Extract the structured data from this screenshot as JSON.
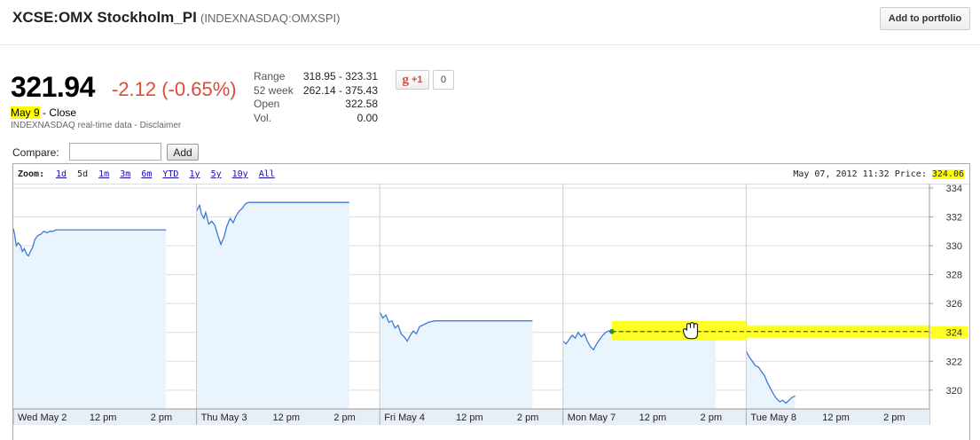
{
  "header": {
    "title": "XCSE:OMX Stockholm_PI",
    "subtitle": "(INDEXNASDAQ:OMXSPI)",
    "add_portfolio": "Add to portfolio"
  },
  "quote": {
    "price": "321.94",
    "change": "-2.12 (-0.65%)",
    "date": "May 9",
    "close_label": "- Close",
    "source": "INDEXNASDAQ real-time data - Disclaimer",
    "colors": {
      "negative": "#dd4b39",
      "highlight": "#ffff00"
    }
  },
  "stats": [
    {
      "label": "Range",
      "value": "318.95 - 323.31"
    },
    {
      "label": "52 week",
      "value": "262.14 - 375.43"
    },
    {
      "label": "Open",
      "value": "322.58"
    },
    {
      "label": "Vol.",
      "value": "0.00"
    }
  ],
  "social": {
    "plus_one": "+1",
    "g_letter": "g",
    "count": "0"
  },
  "compare": {
    "label": "Compare:",
    "value": "",
    "add": "Add"
  },
  "chart_toolbar": {
    "zoom_label": "Zoom:",
    "zoom_options": [
      "1d",
      "5d",
      "1m",
      "3m",
      "6m",
      "YTD",
      "1y",
      "5y",
      "10y",
      "All"
    ],
    "active_zoom": "5d",
    "readout_prefix": "May 07, 2012 11:32 Price:",
    "readout_price": "324.06"
  },
  "chart_data": {
    "type": "area",
    "x_tick_labels": [
      "Wed May 2",
      "12 pm",
      "2 pm",
      "Thu May 3",
      "12 pm",
      "2 pm",
      "Fri May 4",
      "12 pm",
      "2 pm",
      "Mon May 7",
      "12 pm",
      "2 pm",
      "Tue May 8",
      "12 pm",
      "2 pm"
    ],
    "y_ticks": [
      320,
      322,
      324,
      326,
      328,
      330,
      332,
      334
    ],
    "ylim": [
      318.7,
      334.3
    ],
    "reference_line": 324.06,
    "colors": {
      "line": "#3a7bd5",
      "fill": "#eaf4fc",
      "grid": "#dddddd",
      "reference": "#333333",
      "marker": "#2e8b2e"
    },
    "series": [
      {
        "values": [
          [
            0.0,
            331.2
          ],
          [
            0.02,
            330.8
          ],
          [
            0.05,
            330.0
          ],
          [
            0.08,
            330.2
          ],
          [
            0.12,
            330.0
          ],
          [
            0.15,
            329.6
          ],
          [
            0.18,
            329.8
          ],
          [
            0.22,
            329.4
          ],
          [
            0.25,
            329.3
          ],
          [
            0.28,
            329.6
          ],
          [
            0.32,
            329.9
          ],
          [
            0.35,
            330.4
          ],
          [
            0.4,
            330.7
          ],
          [
            0.45,
            330.8
          ],
          [
            0.5,
            331.0
          ],
          [
            0.55,
            330.9
          ],
          [
            0.6,
            331.0
          ],
          [
            0.65,
            331.0
          ],
          [
            0.7,
            331.1
          ],
          [
            0.8,
            331.1
          ],
          [
            1.0,
            331.1
          ],
          [
            1.4,
            331.1
          ],
          [
            1.8,
            331.1
          ],
          [
            2.2,
            331.1
          ],
          [
            2.5,
            331.1
          ],
          [
            3.0,
            332.4
          ],
          [
            3.05,
            332.8
          ],
          [
            3.08,
            332.2
          ],
          [
            3.12,
            331.9
          ],
          [
            3.15,
            332.3
          ],
          [
            3.2,
            331.5
          ],
          [
            3.25,
            331.7
          ],
          [
            3.3,
            331.4
          ],
          [
            3.35,
            330.7
          ],
          [
            3.4,
            330.1
          ],
          [
            3.45,
            330.6
          ],
          [
            3.5,
            331.4
          ],
          [
            3.55,
            331.9
          ],
          [
            3.6,
            331.6
          ],
          [
            3.65,
            332.1
          ],
          [
            3.7,
            332.4
          ],
          [
            3.75,
            332.6
          ],
          [
            3.8,
            332.9
          ],
          [
            3.85,
            333.0
          ],
          [
            4.2,
            333.0
          ],
          [
            4.6,
            333.0
          ],
          [
            5.0,
            333.0
          ],
          [
            5.5,
            333.0
          ],
          [
            6.0,
            325.4
          ],
          [
            6.05,
            325.0
          ],
          [
            6.1,
            325.2
          ],
          [
            6.15,
            324.7
          ],
          [
            6.2,
            324.8
          ],
          [
            6.25,
            324.3
          ],
          [
            6.3,
            324.5
          ],
          [
            6.35,
            323.9
          ],
          [
            6.4,
            323.7
          ],
          [
            6.45,
            323.4
          ],
          [
            6.5,
            323.8
          ],
          [
            6.55,
            324.1
          ],
          [
            6.6,
            323.9
          ],
          [
            6.65,
            324.4
          ],
          [
            6.7,
            324.5
          ],
          [
            6.8,
            324.7
          ],
          [
            6.9,
            324.8
          ],
          [
            7.2,
            324.8
          ],
          [
            7.6,
            324.8
          ],
          [
            8.0,
            324.8
          ],
          [
            8.5,
            324.8
          ],
          [
            9.0,
            323.4
          ],
          [
            9.05,
            323.2
          ],
          [
            9.1,
            323.5
          ],
          [
            9.15,
            323.8
          ],
          [
            9.2,
            323.6
          ],
          [
            9.25,
            324.0
          ],
          [
            9.3,
            323.7
          ],
          [
            9.35,
            323.9
          ],
          [
            9.4,
            323.4
          ],
          [
            9.45,
            323.0
          ],
          [
            9.5,
            322.8
          ],
          [
            9.55,
            323.2
          ],
          [
            9.6,
            323.5
          ],
          [
            9.65,
            323.8
          ],
          [
            9.7,
            324.0
          ],
          [
            9.75,
            324.1
          ],
          [
            9.8,
            324.06
          ],
          [
            10.0,
            324.06
          ],
          [
            10.5,
            324.06
          ],
          [
            11.0,
            324.06
          ],
          [
            11.5,
            324.06
          ],
          [
            12.0,
            322.7
          ],
          [
            12.05,
            322.3
          ],
          [
            12.1,
            322.0
          ],
          [
            12.15,
            321.7
          ],
          [
            12.2,
            321.6
          ],
          [
            12.25,
            321.3
          ],
          [
            12.3,
            321.0
          ],
          [
            12.35,
            320.5
          ],
          [
            12.4,
            320.1
          ],
          [
            12.45,
            319.7
          ],
          [
            12.5,
            319.4
          ],
          [
            12.55,
            319.2
          ],
          [
            12.6,
            319.3
          ],
          [
            12.65,
            319.1
          ],
          [
            12.7,
            319.3
          ],
          [
            12.75,
            319.5
          ],
          [
            12.8,
            319.6
          ]
        ]
      }
    ]
  }
}
